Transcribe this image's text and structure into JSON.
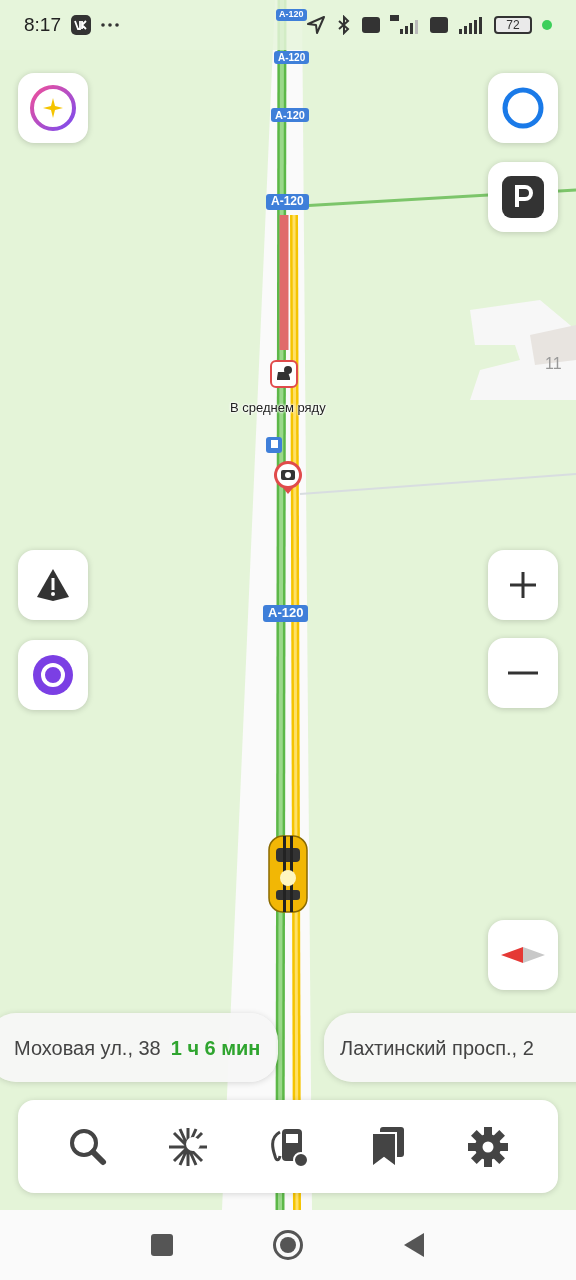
{
  "status_bar": {
    "time": "8:17",
    "battery": "72"
  },
  "map": {
    "road_labels": [
      "A-120",
      "A-120",
      "A-120",
      "A-120",
      "A-120"
    ],
    "lane_hint": "В среднем ряду",
    "building_number": "11"
  },
  "destinations": [
    {
      "address": "Моховая ул., 38",
      "eta": "1 ч 6 мин"
    },
    {
      "address": "Лахтинский просп., 2"
    }
  ]
}
